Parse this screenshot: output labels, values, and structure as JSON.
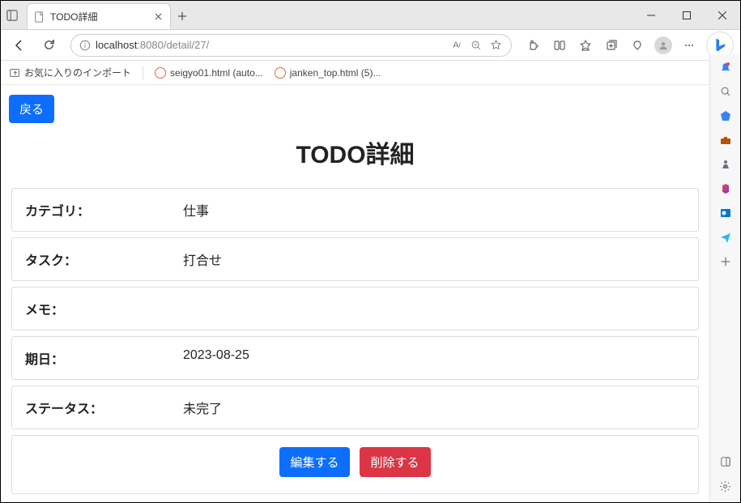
{
  "browser": {
    "tab_title": "TODO詳細",
    "url_host": "localhost",
    "url_port_path": ":8080/detail/27/",
    "bookmarks": {
      "import": "お気に入りのインポート",
      "b1": "seigyo01.html (auto...",
      "b2": "janken_top.html (5)..."
    }
  },
  "page": {
    "back_button": "戻る",
    "title": "TODO詳細",
    "rows": {
      "category_label": "カテゴリ：",
      "category_value": "仕事",
      "task_label": "タスク：",
      "task_value": "打合せ",
      "memo_label": "メモ：",
      "memo_value": "",
      "date_label": "期日：",
      "date_value": "2023-08-25",
      "status_label": "ステータス：",
      "status_value": "未完了"
    },
    "edit_button": "編集する",
    "delete_button": "削除する"
  }
}
